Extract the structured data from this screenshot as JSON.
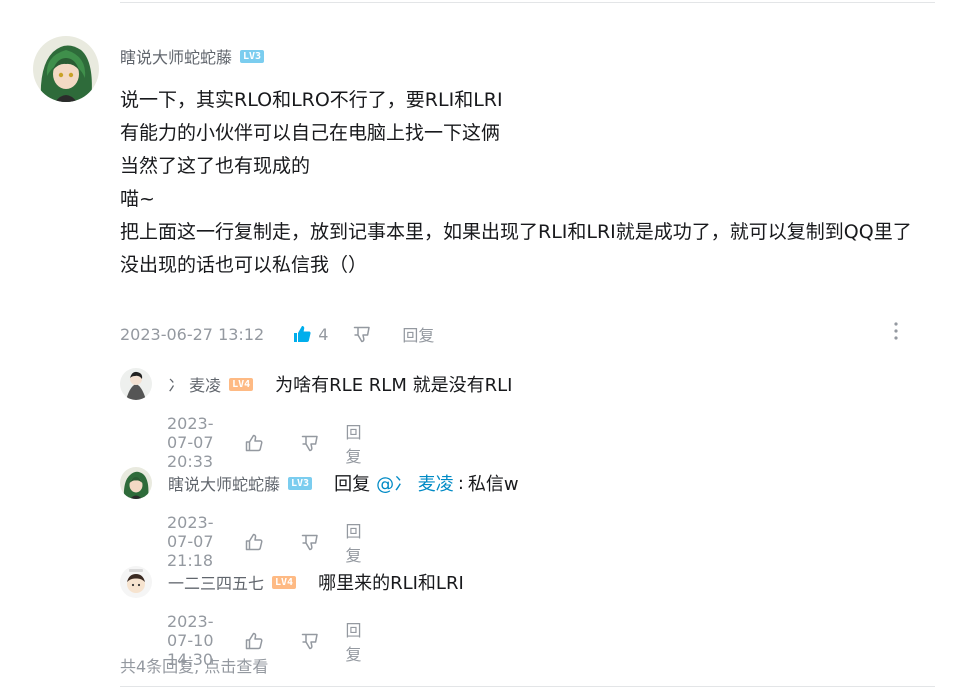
{
  "colors": {
    "accent": "#00aeec",
    "link": "#008ac5",
    "muted": "#9499a0",
    "text": "#18191c",
    "lv3": "#7bcdef",
    "lv4": "#feba84"
  },
  "main_comment": {
    "username": "瞎说大师蛇蛇藤",
    "level": "LV3",
    "lines": [
      "说一下，其实RLO和LRO不行了，要RLI和LRI",
      "有能力的小伙伴可以自己在电脑上找一下这俩",
      "当然了这了也有现成的",
      "喵~",
      "把上面这一行复制走，放到记事本里，如果出现了RLI和LRI就是成功了，就可以复制到QQ里了",
      "没出现的话也可以私信我（）"
    ],
    "time": "2023-06-27 13:12",
    "likes": "4",
    "reply_label": "回复",
    "icons": {
      "like": "thumbs-up-icon",
      "dislike": "thumbs-down-icon",
      "more": "more-vertical-icon"
    }
  },
  "replies": [
    {
      "username": "冫 麦凌",
      "level": "LV4",
      "text": "为啥有RLE RLM 就是没有RLI",
      "time": "2023-07-07 20:33",
      "reply_label": "回复"
    },
    {
      "username": "瞎说大师蛇蛇藤",
      "level": "LV3",
      "reply_word": "回复",
      "mention": "@冫 麦凌",
      "separator": ":",
      "text": "私信w",
      "time": "2023-07-07 21:18",
      "reply_label": "回复"
    },
    {
      "username": "一二三四五七",
      "level": "LV4",
      "text": "哪里来的RLI和LRI",
      "time": "2023-07-10 14:30",
      "reply_label": "回复"
    }
  ],
  "view_all": "共4条回复, 点击查看"
}
